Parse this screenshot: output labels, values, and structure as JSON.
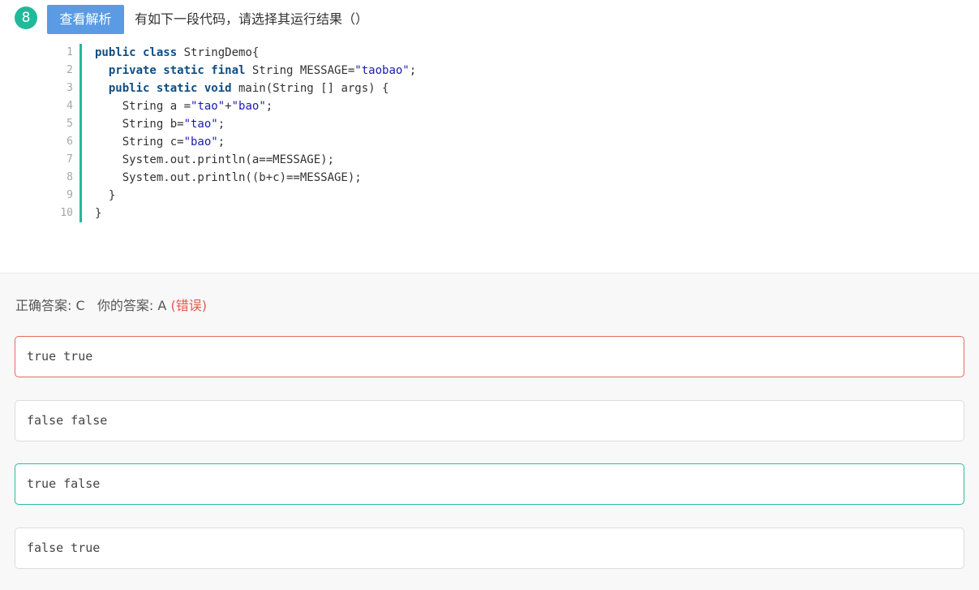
{
  "question": {
    "number": "8",
    "view_button": "查看解析",
    "text": "有如下一段代码，请选择其运行结果（）"
  },
  "code": {
    "line_numbers": [
      "1",
      "2",
      "3",
      "4",
      "5",
      "6",
      "7",
      "8",
      "9",
      "10"
    ],
    "lines": [
      [
        {
          "t": "public class",
          "k": "kw"
        },
        {
          "t": " StringDemo{",
          "k": ""
        }
      ],
      [
        {
          "t": "  ",
          "k": ""
        },
        {
          "t": "private static final",
          "k": "kw"
        },
        {
          "t": " String MESSAGE=",
          "k": ""
        },
        {
          "t": "\"taobao\"",
          "k": "str"
        },
        {
          "t": ";",
          "k": ""
        }
      ],
      [
        {
          "t": "  ",
          "k": ""
        },
        {
          "t": "public static void",
          "k": "kw"
        },
        {
          "t": " main(String [] args) {",
          "k": ""
        }
      ],
      [
        {
          "t": "    String a =",
          "k": ""
        },
        {
          "t": "\"tao\"",
          "k": "str"
        },
        {
          "t": "+",
          "k": ""
        },
        {
          "t": "\"bao\"",
          "k": "str"
        },
        {
          "t": ";",
          "k": ""
        }
      ],
      [
        {
          "t": "    String b=",
          "k": ""
        },
        {
          "t": "\"tao\"",
          "k": "str"
        },
        {
          "t": ";",
          "k": ""
        }
      ],
      [
        {
          "t": "    String c=",
          "k": ""
        },
        {
          "t": "\"bao\"",
          "k": "str"
        },
        {
          "t": ";",
          "k": ""
        }
      ],
      [
        {
          "t": "    System.out.println(a==MESSAGE);",
          "k": ""
        }
      ],
      [
        {
          "t": "    System.out.println((b+c)==MESSAGE);",
          "k": ""
        }
      ],
      [
        {
          "t": "  }",
          "k": ""
        }
      ],
      [
        {
          "t": "}",
          "k": ""
        }
      ]
    ]
  },
  "answer": {
    "correct_label": "正确答案: C",
    "yours_label": "你的答案: A",
    "result": "(错误)"
  },
  "options": [
    {
      "label": "true true",
      "state": "selected-wrong"
    },
    {
      "label": "false false",
      "state": ""
    },
    {
      "label": "true false",
      "state": "correct"
    },
    {
      "label": "false true",
      "state": ""
    }
  ],
  "colors": {
    "accent": "#1fba99",
    "button": "#5b9be3",
    "wrong": "#e05b4c"
  }
}
